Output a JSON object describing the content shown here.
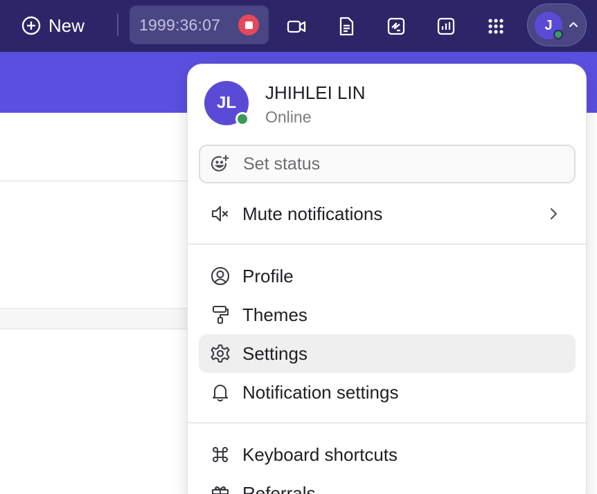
{
  "topbar": {
    "new_label": "New",
    "timer": "1999:36:07",
    "avatar_initial": "J",
    "bg_color": "#2c2568",
    "accent_color": "#5b4fe0",
    "online_color": "#3d9a5a",
    "stop_color": "#e6485a"
  },
  "tools": [
    "video-icon",
    "document-icon",
    "whiteboard-icon",
    "dashboard-icon",
    "apps-grid-icon"
  ],
  "menu": {
    "user": {
      "initials": "JL",
      "name": "JHIHLEI LIN",
      "status": "Online"
    },
    "set_status_placeholder": "Set status",
    "mute_label": "Mute notifications",
    "items": [
      {
        "label": "Profile",
        "icon": "profile-icon"
      },
      {
        "label": "Themes",
        "icon": "paint-roller-icon"
      },
      {
        "label": "Settings",
        "icon": "gear-icon",
        "highlighted": true
      },
      {
        "label": "Notification settings",
        "icon": "bell-icon"
      },
      {
        "label": "Keyboard shortcuts",
        "icon": "command-icon"
      },
      {
        "label": "Referrals",
        "icon": "gift-icon"
      }
    ]
  }
}
